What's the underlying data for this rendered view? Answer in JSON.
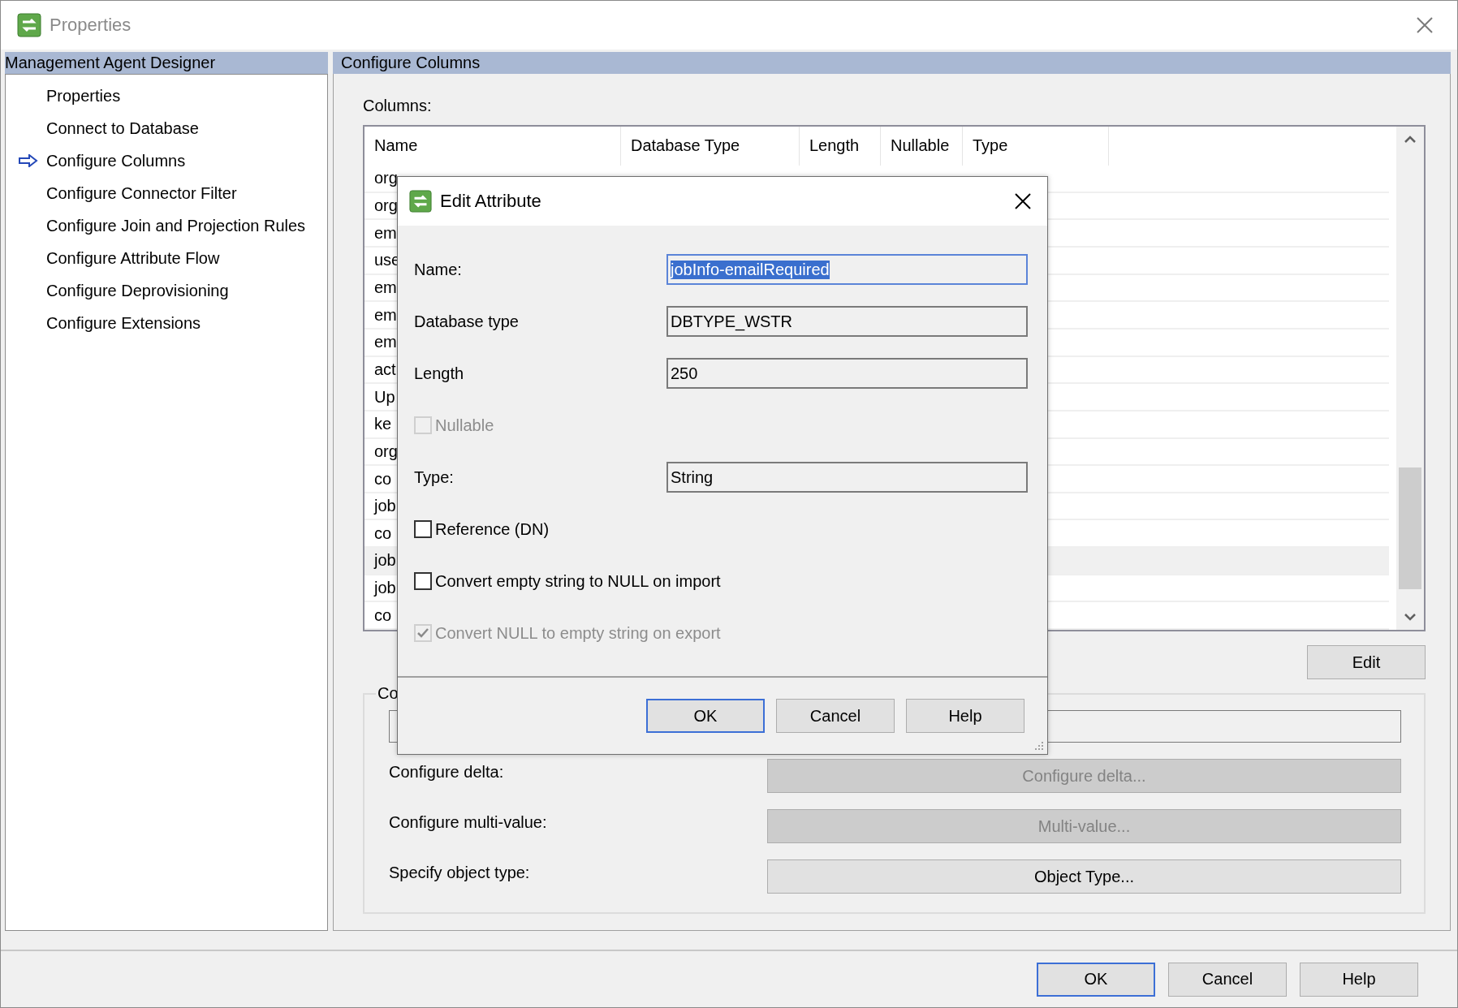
{
  "window": {
    "title": "Properties"
  },
  "sidebar": {
    "header": "Management Agent Designer",
    "items": [
      {
        "label": "Properties",
        "selected": false
      },
      {
        "label": "Connect to Database",
        "selected": false
      },
      {
        "label": "Configure Columns",
        "selected": true
      },
      {
        "label": "Configure Connector Filter",
        "selected": false
      },
      {
        "label": "Configure Join and Projection Rules",
        "selected": false
      },
      {
        "label": "Configure Attribute Flow",
        "selected": false
      },
      {
        "label": "Configure Deprovisioning",
        "selected": false
      },
      {
        "label": "Configure Extensions",
        "selected": false
      }
    ]
  },
  "main": {
    "header": "Configure Columns",
    "columns_label": "Columns:",
    "table": {
      "columns": [
        "Name",
        "Database Type",
        "Length",
        "Nullable",
        "Type"
      ],
      "rows": [
        {
          "name": "org",
          "selected": false
        },
        {
          "name": "org",
          "selected": false
        },
        {
          "name": "em",
          "selected": false
        },
        {
          "name": "use",
          "selected": false
        },
        {
          "name": "em",
          "selected": false
        },
        {
          "name": "em",
          "selected": false
        },
        {
          "name": "em",
          "selected": false
        },
        {
          "name": "act",
          "selected": false
        },
        {
          "name": "Up",
          "selected": false
        },
        {
          "name": "ke",
          "selected": false
        },
        {
          "name": "org",
          "selected": false
        },
        {
          "name": "co",
          "selected": false
        },
        {
          "name": "job",
          "selected": false
        },
        {
          "name": "co",
          "selected": false
        },
        {
          "name": "job",
          "selected": true
        },
        {
          "name": "job",
          "selected": false
        },
        {
          "name": "co",
          "selected": false
        }
      ]
    },
    "edit_button": "Edit",
    "group": {
      "title": "Co",
      "settings": [
        {
          "label": "Configure delta:",
          "button": "Configure delta...",
          "disabled": true
        },
        {
          "label": "Configure multi-value:",
          "button": "Multi-value...",
          "disabled": true
        },
        {
          "label": "Specify object type:",
          "button": "Object Type...",
          "disabled": false
        }
      ]
    }
  },
  "dialog": {
    "title": "Edit Attribute",
    "fields": [
      {
        "kind": "text",
        "label": "Name:",
        "value": "jobInfo-emailRequired",
        "focused": true
      },
      {
        "kind": "text",
        "label": "Database type",
        "value": "DBTYPE_WSTR",
        "focused": false
      },
      {
        "kind": "text",
        "label": "Length",
        "value": "250",
        "focused": false
      },
      {
        "kind": "checkbox",
        "label": "Nullable",
        "checked": false,
        "disabled": true
      },
      {
        "kind": "text",
        "label": "Type:",
        "value": "String",
        "focused": false
      },
      {
        "kind": "checkbox",
        "label": "Reference  (DN)",
        "checked": false,
        "disabled": false
      },
      {
        "kind": "checkbox",
        "label": "Convert empty string to NULL on import",
        "checked": false,
        "disabled": false
      },
      {
        "kind": "checkbox",
        "label": "Convert NULL to empty string on export",
        "checked": true,
        "disabled": true
      }
    ],
    "buttons": [
      {
        "label": "OK",
        "default": true
      },
      {
        "label": "Cancel",
        "default": false
      },
      {
        "label": "Help",
        "default": false
      }
    ]
  },
  "footer_buttons": [
    {
      "label": "OK",
      "default": true
    },
    {
      "label": "Cancel",
      "default": false
    },
    {
      "label": "Help",
      "default": false
    }
  ]
}
